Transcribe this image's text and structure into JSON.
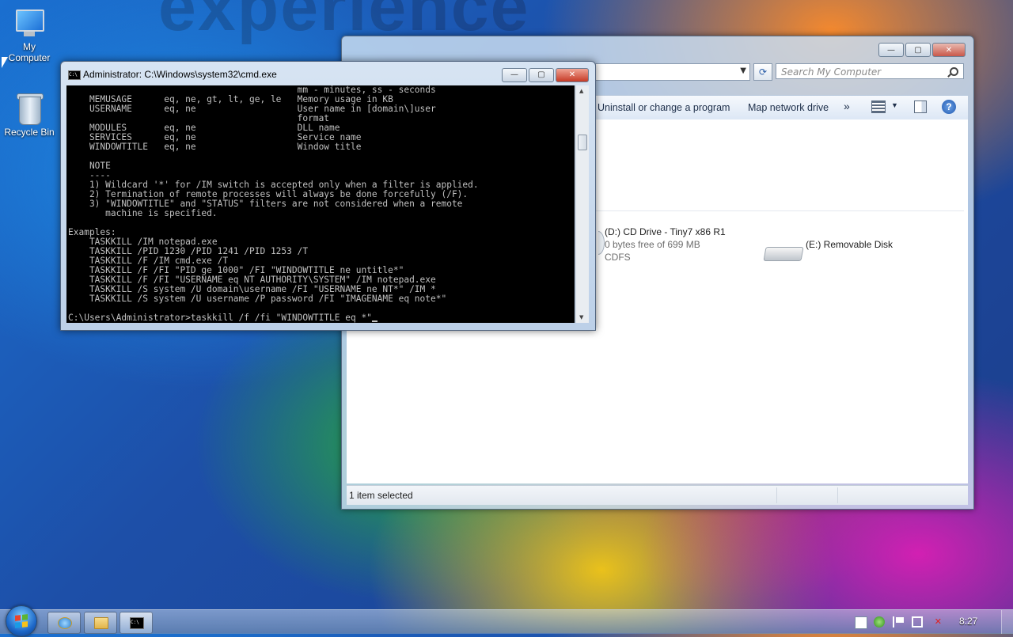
{
  "wallpaper": {
    "brand_text": "experience"
  },
  "desktop": {
    "icons": [
      {
        "label": "My Computer"
      },
      {
        "label": "Recycle Bin"
      }
    ]
  },
  "explorer": {
    "search_placeholder": "Search My Computer",
    "toolbar": {
      "uninstall": "Uninstall or change a program",
      "map_drive": "Map network drive",
      "more": "»"
    },
    "drives": [
      {
        "name": "(D:) CD Drive - Tiny7 x86 R1",
        "free": "0 bytes free of 699 MB",
        "fs": "CDFS"
      },
      {
        "name": "(E:) Removable Disk"
      }
    ],
    "status": "1 item selected",
    "window_controls": {
      "minimize": "—",
      "maximize": "▢",
      "close": "✕"
    }
  },
  "cmd": {
    "title": "Administrator: C:\\Windows\\system32\\cmd.exe",
    "lines": [
      "                                           mm - minutes, ss - seconds",
      "    MEMUSAGE      eq, ne, gt, lt, ge, le   Memory usage in KB",
      "    USERNAME      eq, ne                   User name in [domain\\]user",
      "                                           format",
      "    MODULES       eq, ne                   DLL name",
      "    SERVICES      eq, ne                   Service name",
      "    WINDOWTITLE   eq, ne                   Window title",
      "",
      "    NOTE",
      "    ----",
      "    1) Wildcard '*' for /IM switch is accepted only when a filter is applied.",
      "    2) Termination of remote processes will always be done forcefully (/F).",
      "    3) \"WINDOWTITLE\" and \"STATUS\" filters are not considered when a remote",
      "       machine is specified.",
      "",
      "Examples:",
      "    TASKKILL /IM notepad.exe",
      "    TASKKILL /PID 1230 /PID 1241 /PID 1253 /T",
      "    TASKKILL /F /IM cmd.exe /T",
      "    TASKKILL /F /FI \"PID ge 1000\" /FI \"WINDOWTITLE ne untitle*\"",
      "    TASKKILL /F /FI \"USERNAME eq NT AUTHORITY\\SYSTEM\" /IM notepad.exe",
      "    TASKKILL /S system /U domain\\username /FI \"USERNAME ne NT*\" /IM *",
      "    TASKKILL /S system /U username /P password /FI \"IMAGENAME eq note*\""
    ],
    "prompt": "C:\\Users\\Administrator>taskkill /f /fi \"WINDOWTITLE eq *\"",
    "window_controls": {
      "minimize": "—",
      "maximize": "▢",
      "close": "✕"
    },
    "icon_text": "C:\\"
  },
  "taskbar": {
    "buttons": [
      {
        "icon": "internet-explorer-icon"
      },
      {
        "icon": "folder-icon"
      },
      {
        "icon": "command-prompt-icon",
        "text": "C:\\"
      }
    ],
    "tray_icons": [
      "notepad-icon",
      "network-icon",
      "flag-icon",
      "display-icon",
      "volume-muted-icon"
    ],
    "clock": "8:27"
  }
}
